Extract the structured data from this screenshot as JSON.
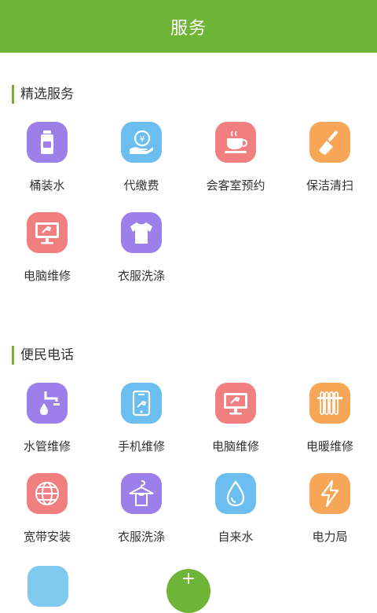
{
  "header": {
    "title": "服务"
  },
  "sections": {
    "featured": {
      "title": "精选服务",
      "items": [
        {
          "label": "桶装水",
          "icon": "water-bottle-icon",
          "color": "#9c7fe8"
        },
        {
          "label": "代缴费",
          "icon": "payment-icon",
          "color": "#6cbdf0"
        },
        {
          "label": "会客室预约",
          "icon": "coffee-cup-icon",
          "color": "#f17f7f"
        },
        {
          "label": "保洁清扫",
          "icon": "broom-icon",
          "color": "#f7a658"
        },
        {
          "label": "电脑维修",
          "icon": "computer-repair-icon",
          "color": "#f17f7f"
        },
        {
          "label": "衣服洗涤",
          "icon": "tshirt-icon",
          "color": "#9c7fe8"
        }
      ]
    },
    "hotline": {
      "title": "便民电话",
      "items": [
        {
          "label": "水管维修",
          "icon": "water-pipe-icon",
          "color": "#9c7fe8"
        },
        {
          "label": "手机维修",
          "icon": "phone-repair-icon",
          "color": "#6cbdf0"
        },
        {
          "label": "电脑维修",
          "icon": "computer-repair-icon",
          "color": "#f17f7f"
        },
        {
          "label": "电暖维修",
          "icon": "radiator-icon",
          "color": "#f7a658"
        },
        {
          "label": "宽带安装",
          "icon": "globe-icon",
          "color": "#f17f7f"
        },
        {
          "label": "衣服洗涤",
          "icon": "clothes-hanger-icon",
          "color": "#9c7fe8"
        },
        {
          "label": "自来水",
          "icon": "water-drop-icon",
          "color": "#6cbdf0"
        },
        {
          "label": "电力局",
          "icon": "lightning-icon",
          "color": "#f7a658"
        }
      ]
    }
  }
}
